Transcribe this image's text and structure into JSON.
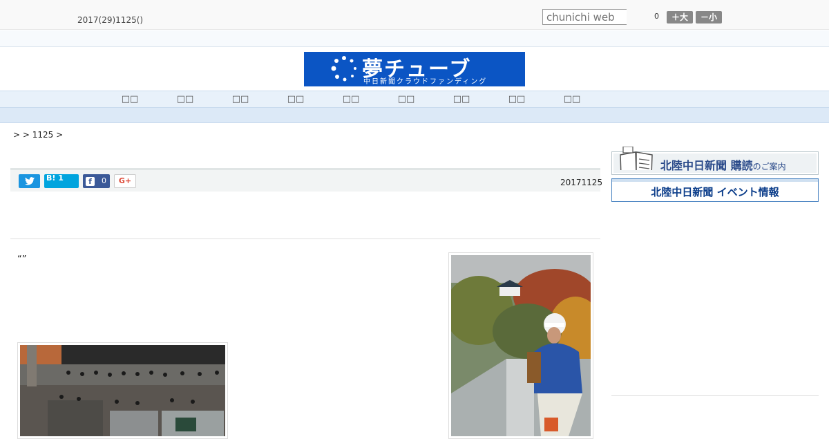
{
  "header": {
    "date": "2017(29)1125()",
    "search_placeholder": "chunichi web",
    "font_count": "0",
    "font_larger": "＋大",
    "font_smaller": "－小"
  },
  "banner": {
    "title": "夢チューブ",
    "subtitle": "中日新聞クラウドファンディング",
    "color": "#0b55c4"
  },
  "nav": {
    "items": [
      "□□",
      "□□",
      "□□",
      "□□",
      "□□",
      "□□",
      "□□",
      "□□",
      "□□"
    ]
  },
  "breadcrumb": ">  > 1125 >",
  "share": {
    "twitter_icon": "twitter-bird-icon",
    "hatena_label": "B! 1",
    "facebook_count": "0",
    "facebook_icon": "f",
    "gplus_label": "G+"
  },
  "article": {
    "published": "20171125",
    "lead": "“”"
  },
  "sidebar": {
    "subscribe_main": "北陸中日新聞 購読",
    "subscribe_suffix": "のご案内",
    "events": "北陸中日新聞 イベント情報"
  }
}
